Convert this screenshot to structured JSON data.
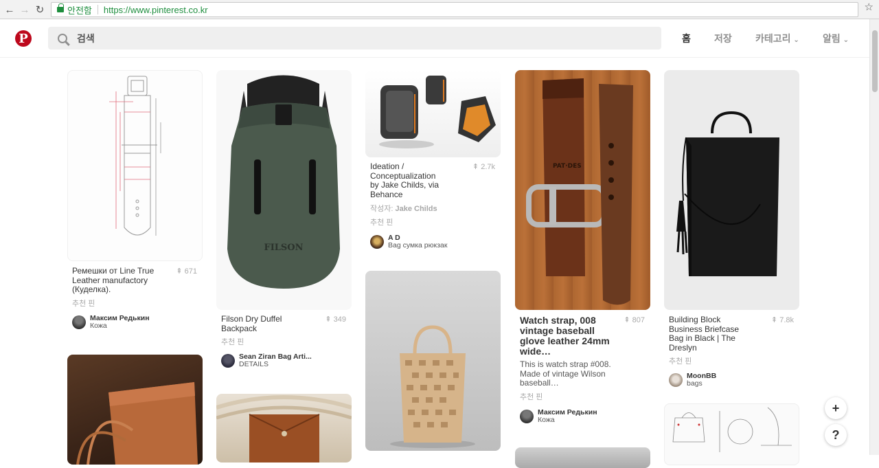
{
  "browser": {
    "secure_label": "안전함",
    "url": "https://www.pinterest.co.kr"
  },
  "header": {
    "search_placeholder": "검색",
    "nav": [
      "홈",
      "저장",
      "카테고리",
      "알림"
    ]
  },
  "pins": [
    {
      "title": "Ремешки от Line True Leather manufactory (Куделка).",
      "saves": "671",
      "sub": "추천 핀",
      "pinner": "Максим Редькин",
      "board": "Кожа"
    },
    {
      "title": "Filson Dry Duffel Backpack",
      "saves": "349",
      "sub": "추천 핀",
      "pinner": "Sean Ziran Bag Arti...",
      "board": "DETAILS"
    },
    {
      "title": "Ideation / Conceptualization by Jake Childs, via Behance",
      "saves": "2.7k",
      "sub_prefix": "작성자:",
      "sub_author": "Jake Childs",
      "sub": "추천 핀",
      "pinner": "A D",
      "board": "Bag сумка рюкзак"
    },
    {
      "title": "Watch strap, 008 vintage baseball glove leather 24mm wide…",
      "saves": "807",
      "desc": "This is watch strap #008. Made of vintage Wilson baseball…",
      "sub": "추천 핀",
      "pinner": "Максим Редькин",
      "board": "Кожа"
    },
    {
      "title": "Building Block Business Briefcase Bag in Black | The Dreslyn",
      "saves": "7.8k",
      "sub": "추천 핀",
      "pinner": "MoonBB",
      "board": "bags"
    }
  ],
  "fab": {
    "add": "+",
    "help": "?"
  },
  "colors": {
    "brand": "#bd081c",
    "secure": "#1e8e3e"
  }
}
